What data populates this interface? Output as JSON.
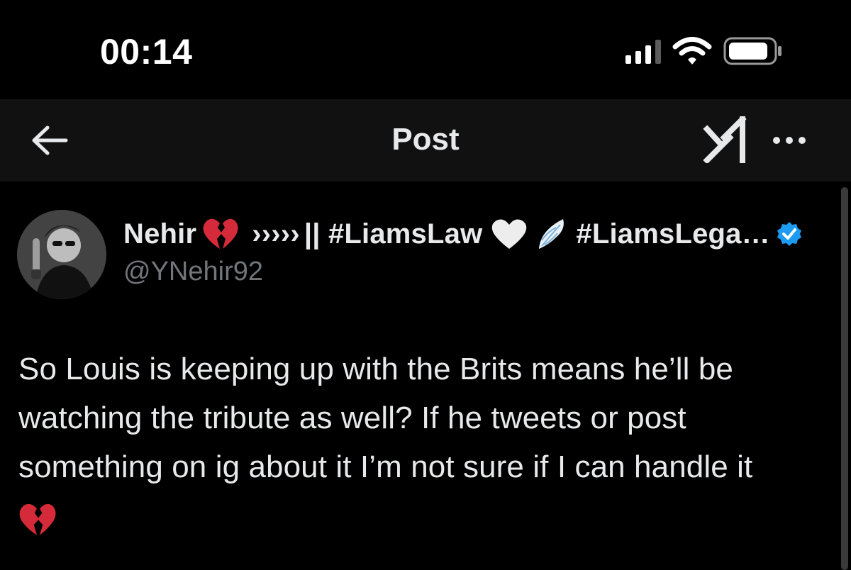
{
  "status_bar": {
    "time": "00:14",
    "icons": [
      "cellular-signal-icon",
      "wifi-icon",
      "battery-icon"
    ]
  },
  "header": {
    "back_icon": "arrow-left-icon",
    "title": "Post",
    "grok_icon": "grok-icon",
    "more_icon": "more-horizontal-icon"
  },
  "post": {
    "author": {
      "name": "Nehir",
      "name_suffix_1": "›››››",
      "name_suffix_2": "|| #LiamsLaw",
      "name_suffix_3": "#LiamsLega…",
      "handle": "@YNehir92",
      "verified": true,
      "badge_color": "#1d9bf0",
      "emoji_icons": [
        "broken-heart-emoji",
        "white-heart-emoji",
        "wing-emoji"
      ]
    },
    "text_lines": [
      "So Louis is keeping up with the Brits means he’ll be",
      "watching the tribute as well? If he tweets or post",
      "something on ig about it I’m not sure if I can handle it"
    ],
    "trailing_emoji": "broken-heart-emoji"
  },
  "colors": {
    "background": "#000000",
    "header_background": "#111111",
    "text_primary": "#e7e9ea",
    "text_secondary": "#71767b",
    "accent": "#1d9bf0",
    "broken_heart": "#d42a3a"
  }
}
